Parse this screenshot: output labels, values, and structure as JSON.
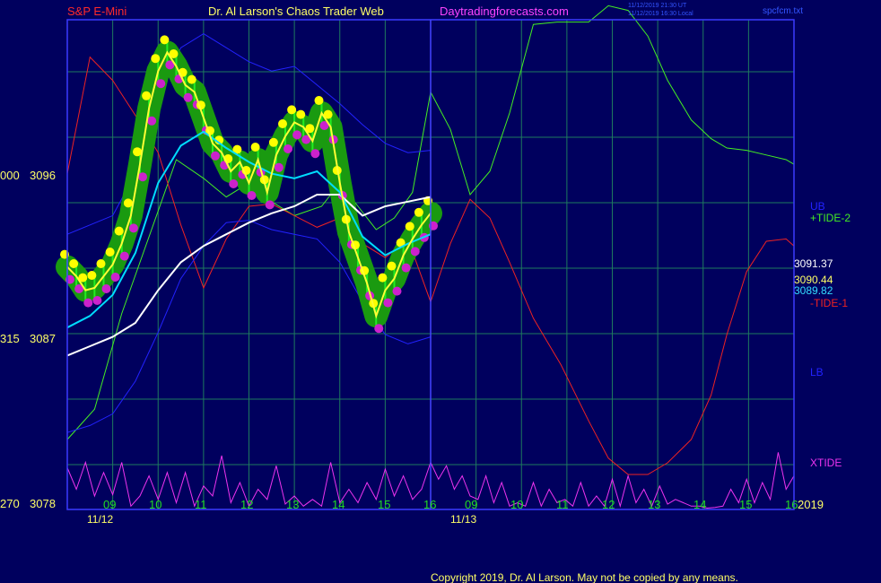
{
  "header": {
    "symbol": "S&P E-Mini",
    "site": "Dr. Al Larson's Chaos Trader Web",
    "url": "Daytradingforecasts.com",
    "time_utc": "11/12/2019 21:30 UT",
    "time_local": "11/12/2019 16:30 Local",
    "file": "spcfcm.txt"
  },
  "footer": {
    "copyright": "Copyright 2019, Dr. Al Larson. May not be copied by any means."
  },
  "colors": {
    "background": "#00005e",
    "grid": "#1e7a5e",
    "axis": "#3a3aff",
    "price": "#ffff33",
    "dot_high": "#ffff00",
    "dot_low": "#cc22cc",
    "halo": "#1a9a10",
    "bar": "#22ee22",
    "ma_fast": "#00ddff",
    "ma_slow": "#ffffff",
    "band_upper": "#2222ff",
    "band_lower": "#2222ff",
    "tide_plus": "#44ee22",
    "tide_minus": "#ee2222",
    "xtide": "#ee33ee",
    "now_line": "#4444ff"
  },
  "chart_data": {
    "type": "line",
    "x_unit": "hour",
    "ylim": [
      3078,
      3099
    ],
    "xlim": [
      8,
      42
    ],
    "y_ticks": [
      {
        "value": 3096,
        "left": "000",
        "label": "3096"
      },
      {
        "value": 3087,
        "left": "315",
        "label": "3087"
      },
      {
        "value": 3078,
        "left": "270",
        "label": "3078"
      }
    ],
    "x_ticks": [
      {
        "x": 9,
        "label": "09"
      },
      {
        "x": 10,
        "label": "10"
      },
      {
        "x": 11,
        "label": "11"
      },
      {
        "x": 12,
        "label": "12"
      },
      {
        "x": 13,
        "label": "13"
      },
      {
        "x": 14,
        "label": "14"
      },
      {
        "x": 15,
        "label": "15"
      },
      {
        "x": 16,
        "label": "16"
      },
      {
        "x": 18,
        "label": "09"
      },
      {
        "x": 19,
        "label": "10"
      },
      {
        "x": 20,
        "label": "11"
      },
      {
        "x": 21,
        "label": "12"
      },
      {
        "x": 22,
        "label": "13"
      },
      {
        "x": 23,
        "label": "14"
      },
      {
        "x": 24,
        "label": "15"
      },
      {
        "x": 25,
        "label": "16"
      }
    ],
    "date_labels": [
      {
        "x": 8.5,
        "label": "11/12"
      },
      {
        "x": 17.6,
        "label": "11/13"
      }
    ],
    "year_label": "2019",
    "now_x": 16,
    "price_readouts": [
      {
        "value": 3091.37,
        "label": "3091.37",
        "color": "#ffffff"
      },
      {
        "value": 3090.44,
        "label": "3090.44",
        "color": "#ffff66"
      },
      {
        "value": 3089.82,
        "label": "3089.82",
        "color": "#33ddff"
      }
    ],
    "legend": [
      {
        "name": "UB",
        "color": "#2222ff"
      },
      {
        "name": "+TIDE-2",
        "color": "#44ee22"
      },
      {
        "name": "-TIDE-1",
        "color": "#ee2222"
      },
      {
        "name": "LB",
        "color": "#2222ff"
      },
      {
        "name": "XTIDE",
        "color": "#ee33ee"
      }
    ],
    "series": [
      {
        "name": "price",
        "x": [
          8.0,
          8.2,
          8.4,
          8.6,
          8.8,
          9.0,
          9.2,
          9.4,
          9.6,
          9.8,
          10.0,
          10.2,
          10.4,
          10.6,
          10.8,
          11.0,
          11.2,
          11.4,
          11.6,
          11.8,
          12.0,
          12.2,
          12.4,
          12.6,
          12.8,
          13.0,
          13.2,
          13.4,
          13.6,
          13.8,
          14.0,
          14.2,
          14.4,
          14.6,
          14.8,
          15.0,
          15.2,
          15.4,
          15.6,
          15.8,
          16.0
        ],
        "y": [
          3088.4,
          3088.0,
          3087.4,
          3087.5,
          3088.0,
          3088.5,
          3089.4,
          3090.6,
          3092.8,
          3095.2,
          3096.8,
          3097.6,
          3097.0,
          3096.2,
          3095.9,
          3094.8,
          3093.7,
          3093.3,
          3092.5,
          3092.9,
          3092.0,
          3093.0,
          3091.6,
          3093.2,
          3094.0,
          3094.6,
          3094.4,
          3093.8,
          3095.0,
          3094.4,
          3092.0,
          3089.9,
          3088.8,
          3087.7,
          3086.3,
          3087.4,
          3087.9,
          3088.9,
          3089.6,
          3090.2,
          3090.7
        ]
      },
      {
        "name": "MA fast",
        "x": [
          8.0,
          8.5,
          9.0,
          9.5,
          10.0,
          10.5,
          11.0,
          11.5,
          12.0,
          12.5,
          13.0,
          13.5,
          14.0,
          14.5,
          15.0,
          15.5,
          16.0
        ],
        "y": [
          3085.8,
          3086.3,
          3087.2,
          3089.0,
          3092.0,
          3093.6,
          3094.2,
          3093.5,
          3092.9,
          3092.4,
          3092.2,
          3092.5,
          3091.6,
          3089.7,
          3088.9,
          3089.4,
          3089.8
        ]
      },
      {
        "name": "MA slow",
        "x": [
          8.0,
          8.5,
          9.0,
          9.5,
          10.0,
          10.5,
          11.0,
          11.5,
          12.0,
          12.5,
          13.0,
          13.5,
          14.0,
          14.5,
          15.0,
          15.5,
          16.0
        ],
        "y": [
          3084.6,
          3085.0,
          3085.4,
          3086.0,
          3087.4,
          3088.6,
          3089.3,
          3089.8,
          3090.3,
          3090.7,
          3091.0,
          3091.5,
          3091.5,
          3090.6,
          3091.0,
          3091.2,
          3091.4
        ]
      },
      {
        "name": "UB",
        "x": [
          8.0,
          8.5,
          9.0,
          9.5,
          10.0,
          10.5,
          11.0,
          11.5,
          12.0,
          12.5,
          13.0,
          13.5,
          14.0,
          14.5,
          15.0,
          15.5,
          16.0
        ],
        "y": [
          3089.8,
          3090.2,
          3090.6,
          3092.4,
          3095.8,
          3097.8,
          3098.4,
          3097.8,
          3097.2,
          3096.8,
          3097.0,
          3096.2,
          3095.4,
          3094.5,
          3093.7,
          3093.3,
          3093.4
        ]
      },
      {
        "name": "LB",
        "x": [
          8.0,
          8.5,
          9.0,
          9.5,
          10.0,
          10.5,
          11.0,
          11.5,
          12.0,
          12.5,
          13.0,
          13.5,
          14.0,
          14.5,
          15.0,
          15.5,
          16.0
        ],
        "y": [
          3081.3,
          3081.6,
          3082.1,
          3083.5,
          3085.6,
          3087.9,
          3089.3,
          3090.3,
          3090.4,
          3090.0,
          3089.8,
          3089.6,
          3088.6,
          3086.9,
          3085.5,
          3085.1,
          3085.4
        ]
      },
      {
        "name": "+TIDE-2",
        "x": [
          8.0,
          8.6,
          9.2,
          10.0,
          10.4,
          11.0,
          11.5,
          12.0,
          12.5,
          13.0,
          13.6,
          14.0,
          14.4,
          14.8,
          15.2,
          15.6,
          16.0,
          16.5,
          17.0,
          17.5,
          18.0,
          18.6,
          19.2,
          20.0,
          20.5,
          21.0,
          21.5,
          22.0,
          22.6,
          23.1,
          23.5,
          24.0,
          24.5,
          25.0,
          25.2
        ],
        "y": [
          3081.0,
          3082.3,
          3086.4,
          3090.8,
          3093.0,
          3092.2,
          3091.4,
          3092.0,
          3091.2,
          3090.6,
          3091.0,
          3092.0,
          3091.0,
          3090.0,
          3090.5,
          3091.6,
          3095.9,
          3094.3,
          3091.5,
          3092.5,
          3095.0,
          3098.8,
          3098.9,
          3098.9,
          3099.6,
          3099.4,
          3098.3,
          3096.4,
          3094.7,
          3093.9,
          3093.5,
          3093.4,
          3093.2,
          3093.0,
          3092.8
        ]
      },
      {
        "name": "-TIDE-1",
        "x": [
          8.0,
          8.5,
          9.0,
          9.5,
          10.0,
          10.5,
          11.0,
          11.5,
          12.0,
          12.5,
          13.0,
          13.5,
          14.0,
          14.5,
          15.0,
          15.5,
          16.0,
          16.5,
          17.0,
          17.5,
          18.0,
          18.6,
          19.3,
          20.0,
          20.5,
          21.0,
          21.5,
          22.0,
          22.6,
          23.1,
          23.5,
          24.0,
          24.5,
          25.0,
          25.2
        ],
        "y": [
          3092.4,
          3097.4,
          3096.4,
          3094.9,
          3093.3,
          3090.2,
          3087.5,
          3089.6,
          3091.0,
          3091.1,
          3090.6,
          3090.1,
          3090.5,
          3089.4,
          3088.8,
          3089.6,
          3086.9,
          3089.4,
          3091.3,
          3090.5,
          3088.6,
          3086.2,
          3084.2,
          3081.8,
          3080.2,
          3079.5,
          3079.5,
          3080.0,
          3081.0,
          3082.9,
          3085.5,
          3088.2,
          3089.5,
          3089.6,
          3089.3
        ]
      },
      {
        "name": "XTIDE",
        "x": [
          8.0,
          8.2,
          8.4,
          8.6,
          8.8,
          9.0,
          9.2,
          9.4,
          9.6,
          9.8,
          10.0,
          10.2,
          10.4,
          10.6,
          10.8,
          11.0,
          11.2,
          11.4,
          11.6,
          11.8,
          12.0,
          12.2,
          12.4,
          12.6,
          12.8,
          13.0,
          13.2,
          13.4,
          13.6,
          13.8,
          14.0,
          14.2,
          14.4,
          14.6,
          14.8,
          15.0,
          15.2,
          15.4,
          15.6,
          15.8,
          16.0,
          16.2,
          16.4,
          16.6,
          16.8,
          17.0,
          17.2,
          17.4,
          17.6,
          17.8,
          18.0,
          18.2,
          18.4,
          18.6,
          18.8,
          19.0,
          19.2,
          19.4,
          19.6,
          19.8,
          20.0,
          20.2,
          20.4,
          20.6,
          20.8,
          21.0,
          21.2,
          21.4,
          21.6,
          21.8,
          22.0,
          22.2,
          22.4,
          22.6,
          22.8,
          23.0,
          23.2,
          23.4,
          23.6,
          23.8,
          24.0,
          24.2,
          24.4,
          24.6,
          24.8,
          25.0,
          25.2
        ],
        "y": [
          0.62,
          0.3,
          0.7,
          0.2,
          0.55,
          0.22,
          0.7,
          0.05,
          0.2,
          0.5,
          0.15,
          0.55,
          0.1,
          0.55,
          0.05,
          0.35,
          0.2,
          0.8,
          0.1,
          0.4,
          0.05,
          0.3,
          0.15,
          0.65,
          0.08,
          0.2,
          0.05,
          0.15,
          0.05,
          0.7,
          0.1,
          0.3,
          0.1,
          0.4,
          0.15,
          0.6,
          0.2,
          0.5,
          0.15,
          0.3,
          0.7,
          0.45,
          0.65,
          0.3,
          0.5,
          0.2,
          0.15,
          0.5,
          0.1,
          0.4,
          0.05,
          0.1,
          0.05,
          0.4,
          0.05,
          0.3,
          0.1,
          0.15,
          0.05,
          0.4,
          0.05,
          0.2,
          0.05,
          0.45,
          0.05,
          0.5,
          0.1,
          0.3,
          0.05,
          0.35,
          0.08,
          0.15,
          0.1,
          0.05,
          0.05,
          0.02,
          0.03,
          0.05,
          0.3,
          0.1,
          0.45,
          0.1,
          0.4,
          0.15,
          0.85,
          0.3,
          0.5
        ]
      }
    ]
  }
}
